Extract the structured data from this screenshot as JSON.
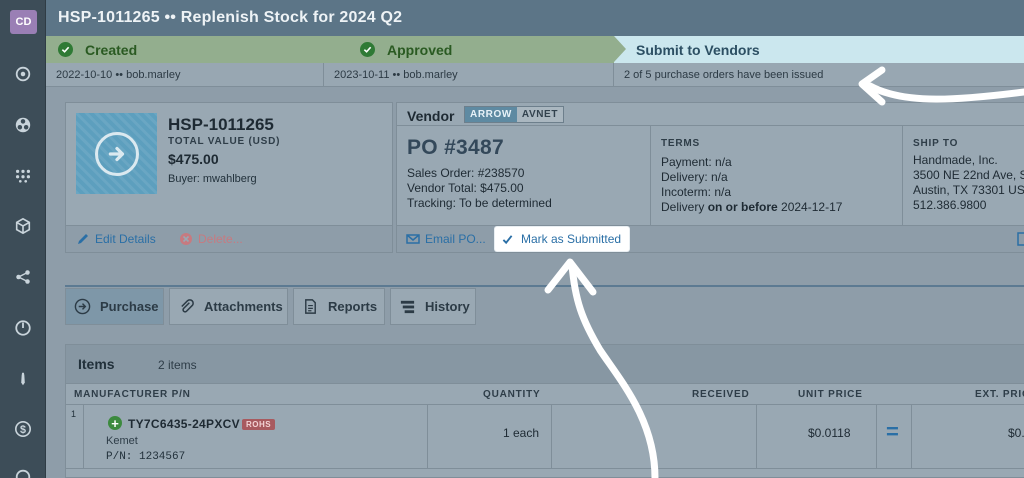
{
  "rail": {
    "avatar": "CD",
    "icons": [
      "orbit-icon",
      "biohazard-icon",
      "dots-grid-icon",
      "cube-icon",
      "share-nodes-icon",
      "gauge-icon",
      "tie-icon",
      "dollar-circle-icon",
      "more-icon"
    ]
  },
  "header": {
    "title": "HSP-1011265 •• Replenish Stock for 2024 Q2"
  },
  "workflow": {
    "steps": [
      {
        "label": "Created",
        "sub": "2022-10-10 •• bob.marley",
        "status": "done"
      },
      {
        "label": "Approved",
        "sub": "2023-10-11 •• bob.marley",
        "status": "done"
      },
      {
        "label": "Submit to Vendors",
        "sub": "2 of 5 purchase orders have been issued",
        "status": "current"
      }
    ]
  },
  "summary": {
    "id": "HSP-1011265",
    "total_label": "TOTAL VALUE (USD)",
    "total_value": "$475.00",
    "buyer": "Buyer: mwahlberg",
    "actions": {
      "edit": "Edit Details",
      "delete": "Delete..."
    }
  },
  "vendor": {
    "label": "Vendor",
    "tabs": [
      "ARROW",
      "AVNET"
    ],
    "active_tab": "ARROW",
    "po": "PO #3487",
    "sales_order": "Sales Order: #238570",
    "vendor_total": "Vendor Total: $475.00",
    "tracking": "Tracking: To be determined",
    "terms": {
      "heading": "TERMS",
      "payment": "Payment: n/a",
      "delivery": "Delivery: n/a",
      "incoterm": "Incoterm: n/a",
      "delivery_prefix": "Delivery ",
      "delivery_bold": "on or before",
      "delivery_date": " 2024-12-17"
    },
    "ship_to": {
      "heading": "SHIP TO",
      "line1": "Handmade, Inc.",
      "line2": "3500 NE 22nd Ave, S",
      "line3": "Austin, TX 73301  US",
      "line4": "512.386.9800"
    },
    "actions": {
      "email": "Email PO...",
      "mark": "Mark as Submitted"
    }
  },
  "tabs": [
    {
      "label": "Purchase",
      "icon": "arrow-circle-icon"
    },
    {
      "label": "Attachments",
      "icon": "paperclip-icon"
    },
    {
      "label": "Reports",
      "icon": "document-icon"
    },
    {
      "label": "History",
      "icon": "history-icon"
    }
  ],
  "items": {
    "title": "Items",
    "count": "2 items",
    "columns": [
      "MANUFACTURER P/N",
      "QUANTITY",
      "RECEIVED",
      "UNIT PRICE",
      "EXT. PRIC"
    ],
    "rows": [
      {
        "num": "1",
        "mpn": "TY7C6435-24PXCV",
        "badge": "ROHS",
        "manufacturer": "Kemet",
        "pn": "P/N: 1234567",
        "quantity": "1 each",
        "received": "",
        "unit_price": "$0.0118",
        "ext_price": "$0."
      }
    ]
  },
  "colors": {
    "accent": "#2a6fa6",
    "success": "#2f7a35",
    "header": "#5c7587",
    "current_step": "#cbe7ee"
  }
}
